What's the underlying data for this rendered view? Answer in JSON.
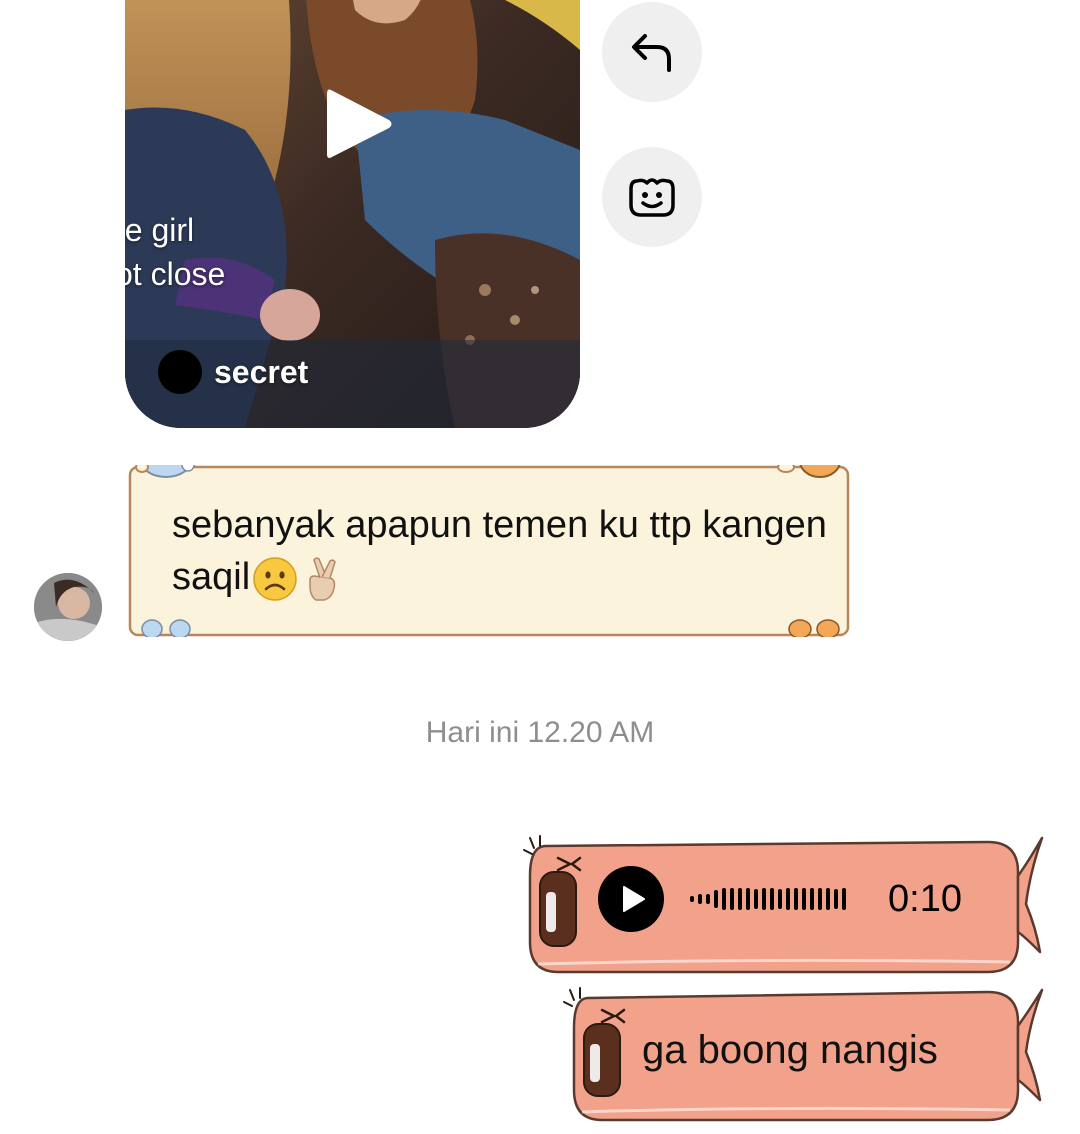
{
  "shared_post": {
    "caption_lines": [
      "ne girl",
      "ot close"
    ],
    "author": "secret"
  },
  "actions": {
    "reply_icon": "reply-arrow-icon",
    "react_icon": "smiley-face-icon"
  },
  "received_message": {
    "text": "sebanyak apapun temen ku ttp kangen saqil",
    "emojis": [
      "frowning-face",
      "crossed-fingers"
    ]
  },
  "timestamp": "Hari ini 12.20 AM",
  "sent_messages": {
    "voice": {
      "duration": "0:10"
    },
    "text": "ga boong nangis"
  },
  "colors": {
    "received_bubble": "#fbf3dc",
    "received_border": "#b9865a",
    "sent_bubble": "#f2a28a",
    "sent_border": "#5a3a2e",
    "timestamp": "#8e8e8e",
    "action_button_bg": "#efefef"
  }
}
